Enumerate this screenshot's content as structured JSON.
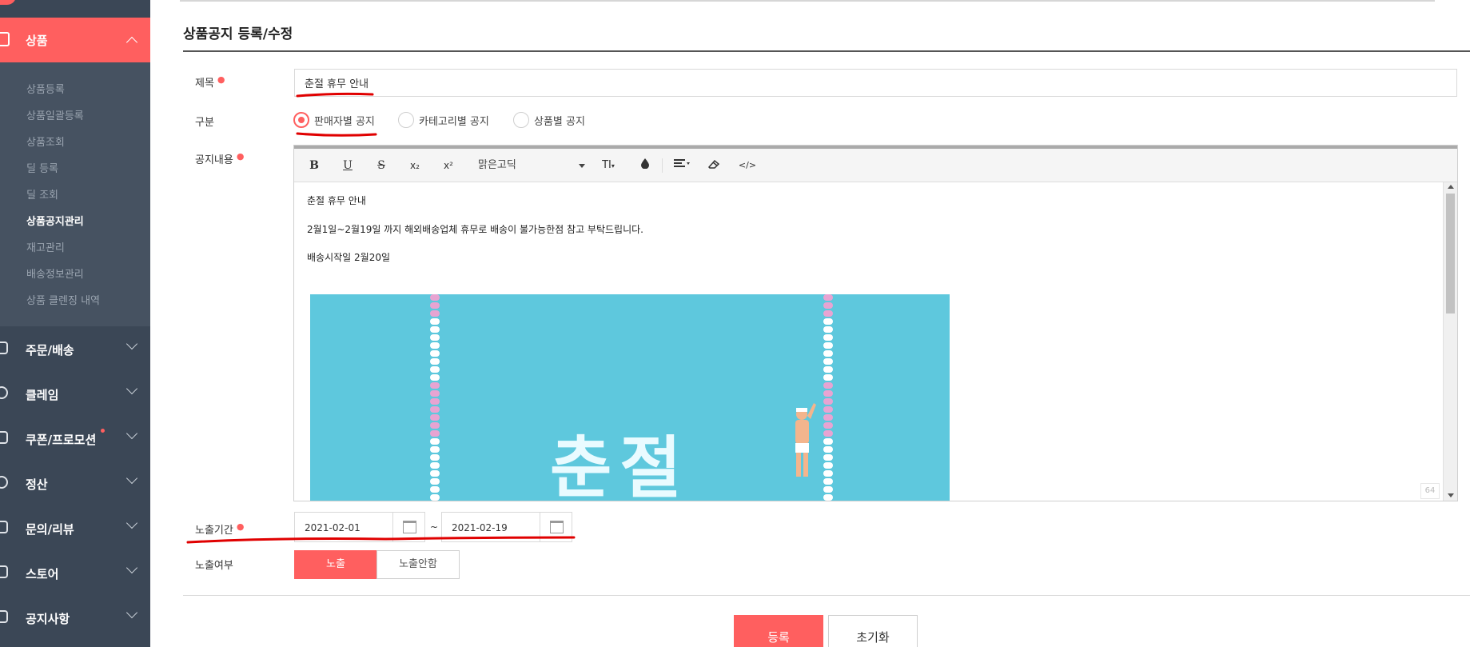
{
  "sidebar": {
    "active_section": {
      "label": "상품",
      "icon": "calendar-icon"
    },
    "sub_items": [
      {
        "label": "상품등록"
      },
      {
        "label": "상품일괄등록"
      },
      {
        "label": "상품조회"
      },
      {
        "label": "딜 등록"
      },
      {
        "label": "딜 조회"
      },
      {
        "label": "상품공지관리",
        "current": true
      },
      {
        "label": "재고관리"
      },
      {
        "label": "배송정보관리"
      },
      {
        "label": "상품 클렌징 내역"
      }
    ],
    "sections": [
      {
        "label": "주문/배송",
        "icon": "truck-icon"
      },
      {
        "label": "클레임",
        "icon": "claim-icon"
      },
      {
        "label": "쿠폰/프로모션",
        "icon": "coupon-icon",
        "badge_dot": true
      },
      {
        "label": "정산",
        "icon": "won-icon"
      },
      {
        "label": "문의/리뷰",
        "icon": "chat-icon"
      },
      {
        "label": "스토어",
        "icon": "store-icon"
      },
      {
        "label": "공지사항",
        "icon": "megaphone-icon"
      }
    ]
  },
  "page": {
    "title": "상품공지 등록/수정"
  },
  "form": {
    "title_label": "제목",
    "title_value": "춘절 휴무 안내",
    "category_label": "구분",
    "category_options": [
      "판매자별 공지",
      "카테고리별 공지",
      "상품별 공지"
    ],
    "category_selected": "판매자별 공지",
    "content_label": "공지내용",
    "period_label": "노출기간",
    "period_start": "2021-02-01",
    "period_end": "2021-02-19",
    "period_separator": "~",
    "visibility_label": "노출여부",
    "visibility_options": [
      "노출",
      "노출안함"
    ],
    "visibility_selected": "노출"
  },
  "editor": {
    "toolbar": {
      "bold": "B",
      "underline": "U",
      "strike": "S",
      "subscript": "x₂",
      "superscript": "x²",
      "font_family": "맑은고딕",
      "font_size": "TI",
      "color_icon": "ink-drop-icon",
      "align_icon": "align-left-icon",
      "eraser_icon": "eraser-icon",
      "code_view": "</>"
    },
    "content_lines": [
      "춘절 휴무 안내",
      "2월1일~2월19일 까지 해외배송업체 휴무로 배송이 불가능한점 참고 부탁드립니다.",
      "배송시작일 2월20일"
    ],
    "banner_text": "춘절",
    "resize_label": "64"
  },
  "buttons": {
    "submit": "등록",
    "reset": "초기화"
  },
  "colors": {
    "accent": "#ff5f5f",
    "sidebar_bg": "#3b4756",
    "banner_bg": "#5ec8dd"
  }
}
